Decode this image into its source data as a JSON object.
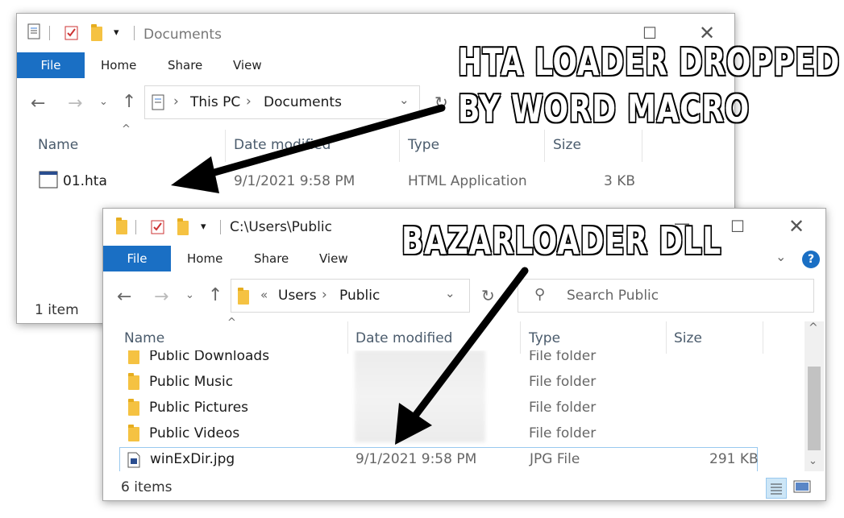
{
  "window_back": {
    "title": "Documents",
    "ribbon": {
      "file": "File",
      "home": "Home",
      "share": "Share",
      "view": "View"
    },
    "address": {
      "segments": [
        "This PC",
        "Documents"
      ]
    },
    "columns": {
      "name": "Name",
      "date": "Date modified",
      "type": "Type",
      "size": "Size"
    },
    "files": [
      {
        "name": "01.hta",
        "date": "9/1/2021 9:58 PM",
        "type": "HTML Application",
        "size": "3 KB"
      }
    ],
    "status": "1 item"
  },
  "window_front": {
    "title": "C:\\Users\\Public",
    "ribbon": {
      "file": "File",
      "home": "Home",
      "share": "Share",
      "view": "View"
    },
    "address": {
      "prefix": "«",
      "segments": [
        "Users",
        "Public"
      ]
    },
    "search_placeholder": "Search Public",
    "columns": {
      "name": "Name",
      "date": "Date modified",
      "type": "Type",
      "size": "Size"
    },
    "files": [
      {
        "name": "Public Downloads",
        "date": "",
        "type": "File folder",
        "size": ""
      },
      {
        "name": "Public Music",
        "date": "",
        "type": "File folder",
        "size": ""
      },
      {
        "name": "Public Pictures",
        "date": "",
        "type": "File folder",
        "size": ""
      },
      {
        "name": "Public Videos",
        "date": "",
        "type": "File folder",
        "size": ""
      },
      {
        "name": "winExDir.jpg",
        "date": "9/1/2021 9:58 PM",
        "type": "JPG File",
        "size": "291 KB"
      }
    ],
    "status": "6 items"
  },
  "annotations": {
    "hta": {
      "line1": "HTA LOADER DROPPED",
      "line2": "BY WORD MACRO"
    },
    "dll": {
      "line1": "BAZARLOADER DLL"
    }
  },
  "colors": {
    "accent": "#1a6fc4",
    "selection": "#99c9ef",
    "folder": "#f5c242"
  }
}
